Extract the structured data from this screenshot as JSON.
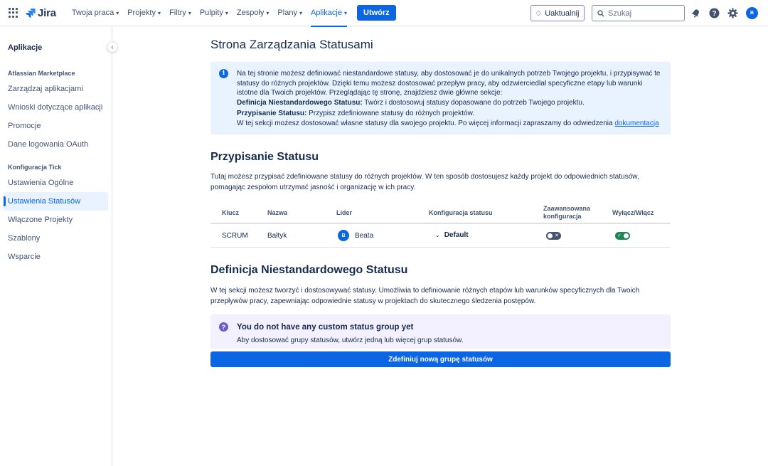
{
  "app": {
    "name": "Jira"
  },
  "nav": {
    "items": [
      {
        "label": "Twoja praca"
      },
      {
        "label": "Projekty"
      },
      {
        "label": "Filtry"
      },
      {
        "label": "Pulpity"
      },
      {
        "label": "Zespoły"
      },
      {
        "label": "Plany"
      },
      {
        "label": "Aplikacje"
      }
    ],
    "active": "Aplikacje",
    "create_label": "Utwórz",
    "upgrade_label": "Uaktualnij",
    "search_placeholder": "Szukaj",
    "avatar_initial": "B"
  },
  "sidebar": {
    "title": "Aplikacje",
    "sections": [
      {
        "label": "Atlassian Marketplace",
        "items": [
          {
            "label": "Zarządzaj aplikacjami"
          },
          {
            "label": "Wnioski dotyczące aplikacji"
          },
          {
            "label": "Promocje"
          },
          {
            "label": "Dane logowania OAuth"
          }
        ]
      },
      {
        "label": "Konfiguracja Tick",
        "items": [
          {
            "label": "Ustawienia Ogólne"
          },
          {
            "label": "Ustawienia Statusów"
          },
          {
            "label": "Włączone Projekty"
          },
          {
            "label": "Szablony"
          },
          {
            "label": "Wsparcie"
          }
        ]
      }
    ],
    "active_item": "Ustawienia Statusów"
  },
  "main": {
    "title": "Strona Zarządzania Statusami",
    "info": {
      "intro": "Na tej stronie możesz definiować niestandardowe statusy, aby dostosować je do unikalnych potrzeb Twojego projektu, i przypisywać te statusy do różnych projektów. Dzięki temu możesz dostosować przepływ pracy, aby odzwierciedlał specyficzne etapy lub warunki istotne dla Twoich projektów. Przeglądając tę stronę, znajdziesz dwie główne sekcje:",
      "def_label": "Definicja Niestandardowego Statusu:",
      "def_text": " Twórz i dostosowuj statusy dopasowane do potrzeb Twojego projektu.",
      "assign_label": "Przypisanie Statusu:",
      "assign_text": " Przypisz zdefiniowane statusy do różnych projektów.",
      "more_text": "W tej sekcji możesz dostosować własne statusy dla swojego projektu. Po więcej informacji zapraszamy do odwiedzenia ",
      "link_text": "dokumentacja"
    },
    "assignment": {
      "title": "Przypisanie Statusu",
      "desc": "Tutaj możesz przypisać zdefiniowane statusy do różnych projektów. W ten sposób dostosujesz każdy projekt do odpowiednich statusów, pomagając zespołom utrzymać jasność i organizację w ich pracy.",
      "columns": {
        "key": "Klucz",
        "name": "Nazwa",
        "lead": "Lider",
        "config": "Konfiguracja statusu",
        "advanced_1": "Zaawansowana",
        "advanced_2": "konfiguracja",
        "toggle": "Wyłącz/Włącz"
      },
      "rows": [
        {
          "key": "SCRUM",
          "name": "Bałtyk",
          "lead_initial": "B",
          "lead": "Beata",
          "config": "Default",
          "advanced_enabled": false,
          "enabled": true
        }
      ]
    },
    "custom": {
      "title": "Definicja Niestandardowego Statusu",
      "desc": "W tej sekcji możesz tworzyć i dostosowywać statusy. Umożliwia to definiowanie różnych etapów lub warunków specyficznych dla Twoich przepływów pracy, zapewniając odpowiednie statusy w projektach do skutecznego śledzenia postępów.",
      "empty_title": "You do not have any custom status group yet",
      "empty_sub": "Aby dostosować grupy statusów, utwórz jedną lub więcej grup statusów.",
      "button": "Zdefiniuj nową grupę statusów"
    }
  },
  "colors": {
    "brand": "#0c66e4",
    "toggle_on": "#1f845a",
    "toggle_off": "#44546f",
    "info_bg": "#e9f2ff",
    "empty_bg": "#f3f0ff"
  }
}
